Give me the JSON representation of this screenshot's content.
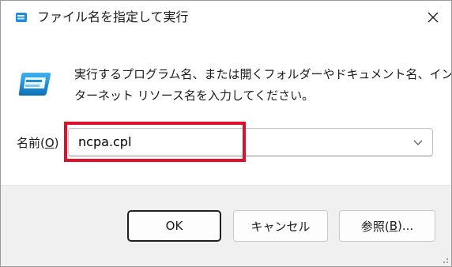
{
  "window": {
    "title": "ファイル名を指定して実行",
    "title_icon": "run-icon",
    "close_icon": "close-icon"
  },
  "body": {
    "icon": "run-dialog-icon",
    "description_line1": "実行するプログラム名、または開くフォルダーやドキュメント名、イン",
    "description_line2": "ターネット リソース名を入力してください。",
    "open_label_prefix": "名前(",
    "open_label_accel": "O",
    "open_label_suffix": ")",
    "open_value": "ncpa.cpl",
    "dropdown_icon": "chevron-down-icon"
  },
  "buttons": {
    "ok_label": "OK",
    "cancel_label": "キャンセル",
    "browse_prefix": "参照(",
    "browse_accel": "B",
    "browse_suffix": ")..."
  },
  "colors": {
    "highlight": "#e0102a",
    "footer_bg": "#f0f0f0",
    "icon_blue": "#1e8fd6"
  }
}
